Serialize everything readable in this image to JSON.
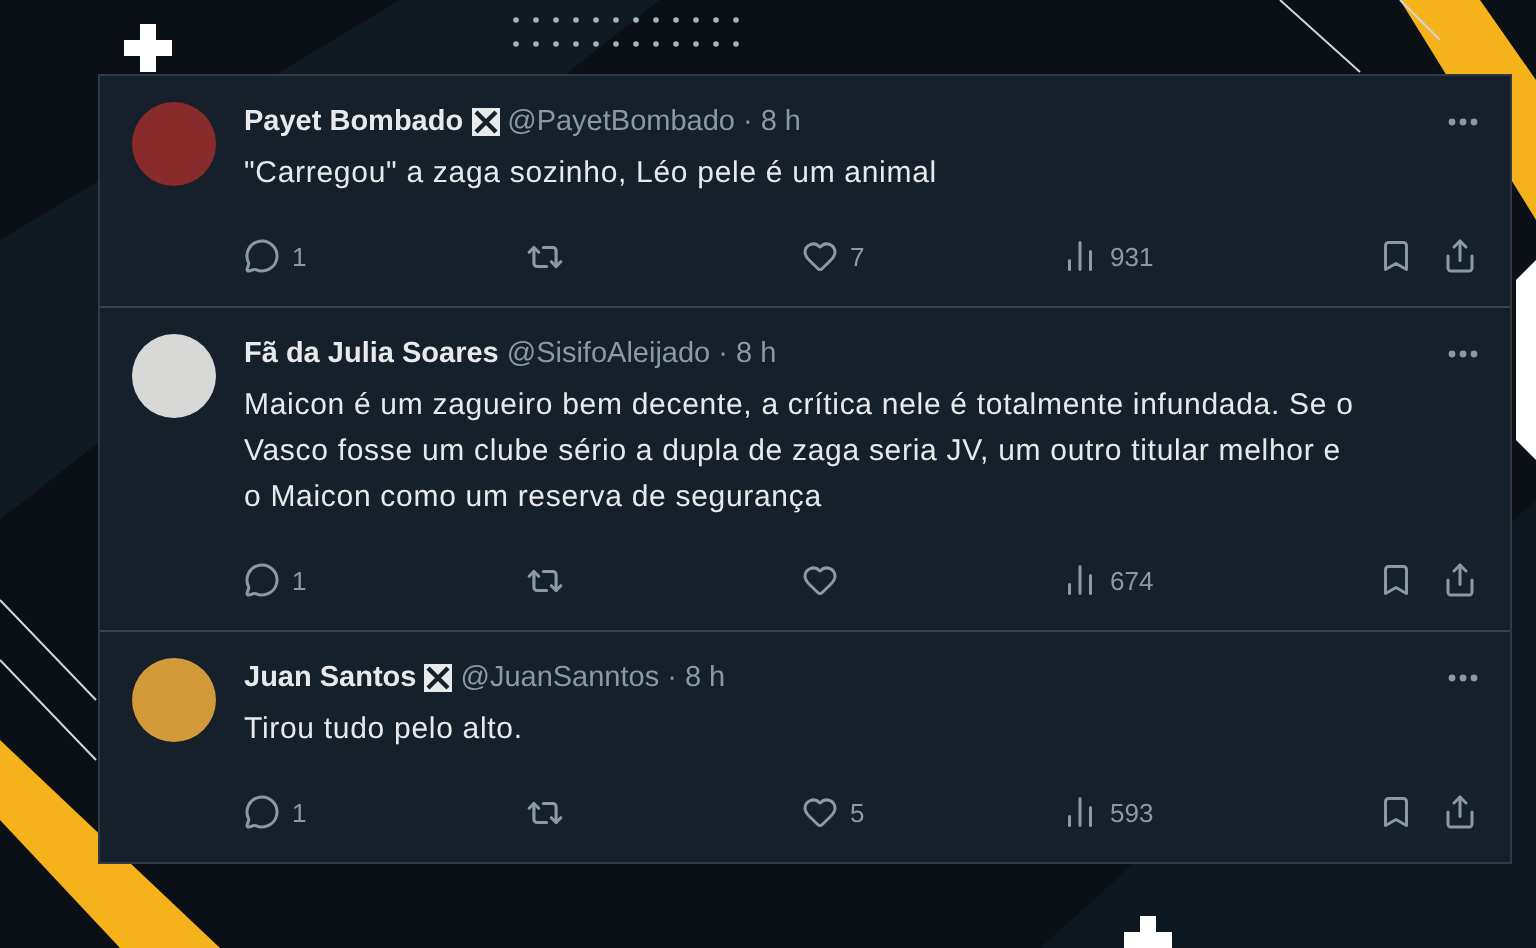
{
  "tweets": [
    {
      "name": "Payet Bombado",
      "club_badge": true,
      "handle": "@PayetBombado",
      "time": "· 8 h",
      "text": "\"Carregou\" a zaga sozinho, Léo pele é um animal",
      "replies": "1",
      "likes": "7",
      "views": "931"
    },
    {
      "name": "Fã da Julia Soares",
      "club_badge": false,
      "handle": "@SisifoAleijado",
      "time": "· 8 h",
      "text": "Maicon é um zagueiro bem decente, a crítica nele é totalmente infundada. Se o Vasco fosse um clube sério a dupla de zaga seria JV, um outro titular melhor e o Maicon como um reserva de segurança",
      "replies": "1",
      "views": "674"
    },
    {
      "name": "Juan Santos",
      "club_badge": true,
      "handle": "@JuanSanntos",
      "time": "· 8 h",
      "text": "Tirou tudo pelo alto.",
      "replies": "1",
      "likes": "5",
      "views": "593"
    }
  ]
}
